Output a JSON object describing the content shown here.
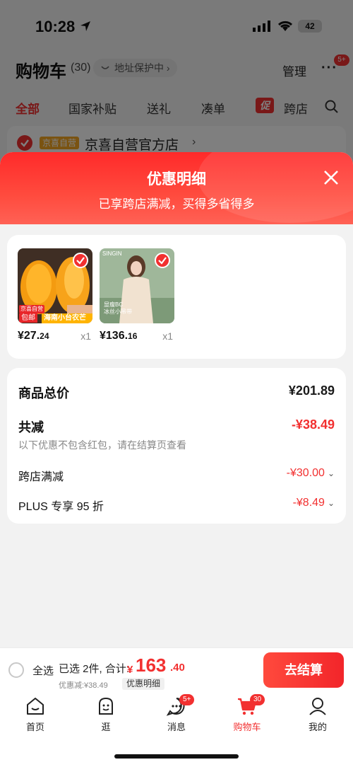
{
  "status_bar": {
    "time": "10:28",
    "battery": "42"
  },
  "cart_header": {
    "title": "购物车",
    "count": "(30)",
    "address_protection": "地址保护中",
    "manage": "管理",
    "more_badge": "5+"
  },
  "tabs": [
    {
      "label": "全部",
      "active": true
    },
    {
      "label": "国家补贴"
    },
    {
      "label": "送礼"
    },
    {
      "label": "凑单"
    },
    {
      "label": "跨店",
      "icon_text": "促"
    }
  ],
  "store": {
    "tag": "京喜自营",
    "name": "京喜自营官方店"
  },
  "sheet": {
    "title": "优惠明细",
    "subtitle": "已享跨店满减，买得多省得多"
  },
  "products": [
    {
      "name_tag": "海南小台农芒果",
      "shipping_tag": "包邮",
      "self_tag": "京喜自营",
      "price_main": "¥27.",
      "price_dec": "24",
      "qty": "x1",
      "colors": [
        "#f6a21c",
        "#5b4632"
      ]
    },
    {
      "brand": "SINGIN",
      "img_text1": "显瘦BC",
      "img_text2": "冰丝小吊带",
      "price_main": "¥136.",
      "price_dec": "16",
      "qty": "x1",
      "colors": [
        "#e8dcc8",
        "#6c8f70"
      ]
    }
  ],
  "summary": {
    "total_label": "商品总价",
    "total_value": "¥201.89",
    "reduced_label": "共减",
    "reduced_value": "-¥38.49",
    "note": "以下优惠不包含红包，请在结算页查看",
    "items": [
      {
        "label": "跨店满减",
        "value": "-¥30.00"
      },
      {
        "label": "PLUS 专享 95 折",
        "value": "-¥8.49"
      }
    ]
  },
  "checkout": {
    "select_all": "全选",
    "selected_info": "已选 2件, 合计:",
    "currency": "¥",
    "total_main": "163",
    "total_dec": ".40",
    "discount_line": "优惠减:¥38.49",
    "detail_link": "优惠明细",
    "button": "去结算"
  },
  "tabbar": [
    {
      "label": "首页",
      "icon": "home-icon"
    },
    {
      "label": "逛",
      "icon": "browse-icon"
    },
    {
      "label": "消息",
      "icon": "message-icon",
      "badge": "5+"
    },
    {
      "label": "购物车",
      "icon": "cart-icon",
      "badge": "30",
      "active": true
    },
    {
      "label": "我的",
      "icon": "profile-icon"
    }
  ],
  "accent_color": "#f23030"
}
